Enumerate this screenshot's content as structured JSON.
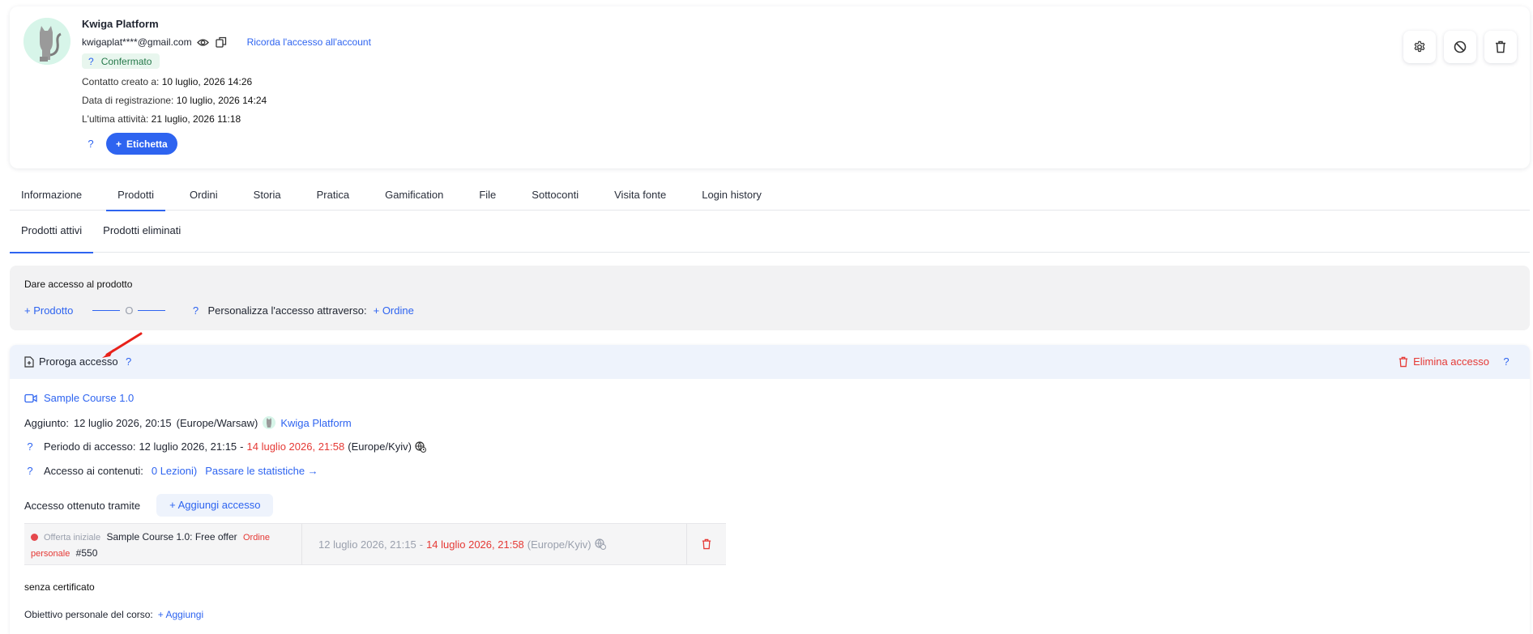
{
  "colors": {
    "accent": "#2e64f0",
    "danger": "#e53935",
    "success_bg": "#e8f6ee",
    "success_text": "#25794a"
  },
  "profile": {
    "name": "Kwiga Platform",
    "email": "kwigaplat****@gmail.com",
    "remind_link": "Ricorda l'accesso all'account",
    "status_help": "?",
    "status": "Confermato",
    "created_label": "Contatto creato a:",
    "created_value": "10 luglio, 2026 14:26",
    "registered_label": "Data di registrazione:",
    "registered_value": "10 luglio, 2026 14:24",
    "last_activity_label": "L'ultima attività:",
    "last_activity_value": "21 luglio, 2026 11:18",
    "tag_help": "?",
    "tag_button": "Etichetta"
  },
  "tabs": [
    "Informazione",
    "Prodotti",
    "Ordini",
    "Storia",
    "Pratica",
    "Gamification",
    "File",
    "Sottoconti",
    "Visita fonte",
    "Login history"
  ],
  "active_tab": "Prodotti",
  "subtabs": [
    "Prodotti attivi",
    "Prodotti eliminati"
  ],
  "give_access": {
    "title": "Dare accesso al prodotto",
    "product_link": "+ Prodotto",
    "or": "O",
    "help": "?",
    "custom_label": "Personalizza l'accesso attraverso:",
    "order_link": "+ Ordine"
  },
  "product": {
    "extend_label": "Proroga accesso",
    "extend_help": "?",
    "delete_label": "Elimina accesso",
    "delete_help": "?",
    "course_name": "Sample Course 1.0",
    "added_label": "Aggiunto:",
    "added_value": "12 luglio 2026, 20:15",
    "added_tz": "(Europe/Warsaw)",
    "added_by": "Kwiga Platform",
    "period_help": "?",
    "period_label": "Periodo di accesso:",
    "period_start": "12 luglio 2026, 21:15",
    "period_dash": "-",
    "period_end": "14 luglio 2026, 21:58",
    "period_tz": "(Europe/Kyiv)",
    "content_help": "?",
    "content_label": "Accesso ai contenuti:",
    "content_lessons": "0 Lezioni)",
    "stats_link": "Passare le statistiche →",
    "obtained_label": "Accesso ottenuto tramite",
    "add_access_button": "+ Aggiungi accesso",
    "row": {
      "offer_type": "Offerta iniziale",
      "offer_name": "Sample Course 1.0: Free offer",
      "order_type_1": "Ordine",
      "order_type_2": "personale",
      "order_number": "#550",
      "start": "12 luglio 2026, 21:15",
      "dash": "-",
      "end": "14 luglio 2026, 21:58",
      "tz": "(Europe/Kyiv)"
    },
    "certificate": "senza certificato",
    "goal_label": "Obiettivo personale del corso:",
    "goal_link": "+ Aggiungi"
  }
}
